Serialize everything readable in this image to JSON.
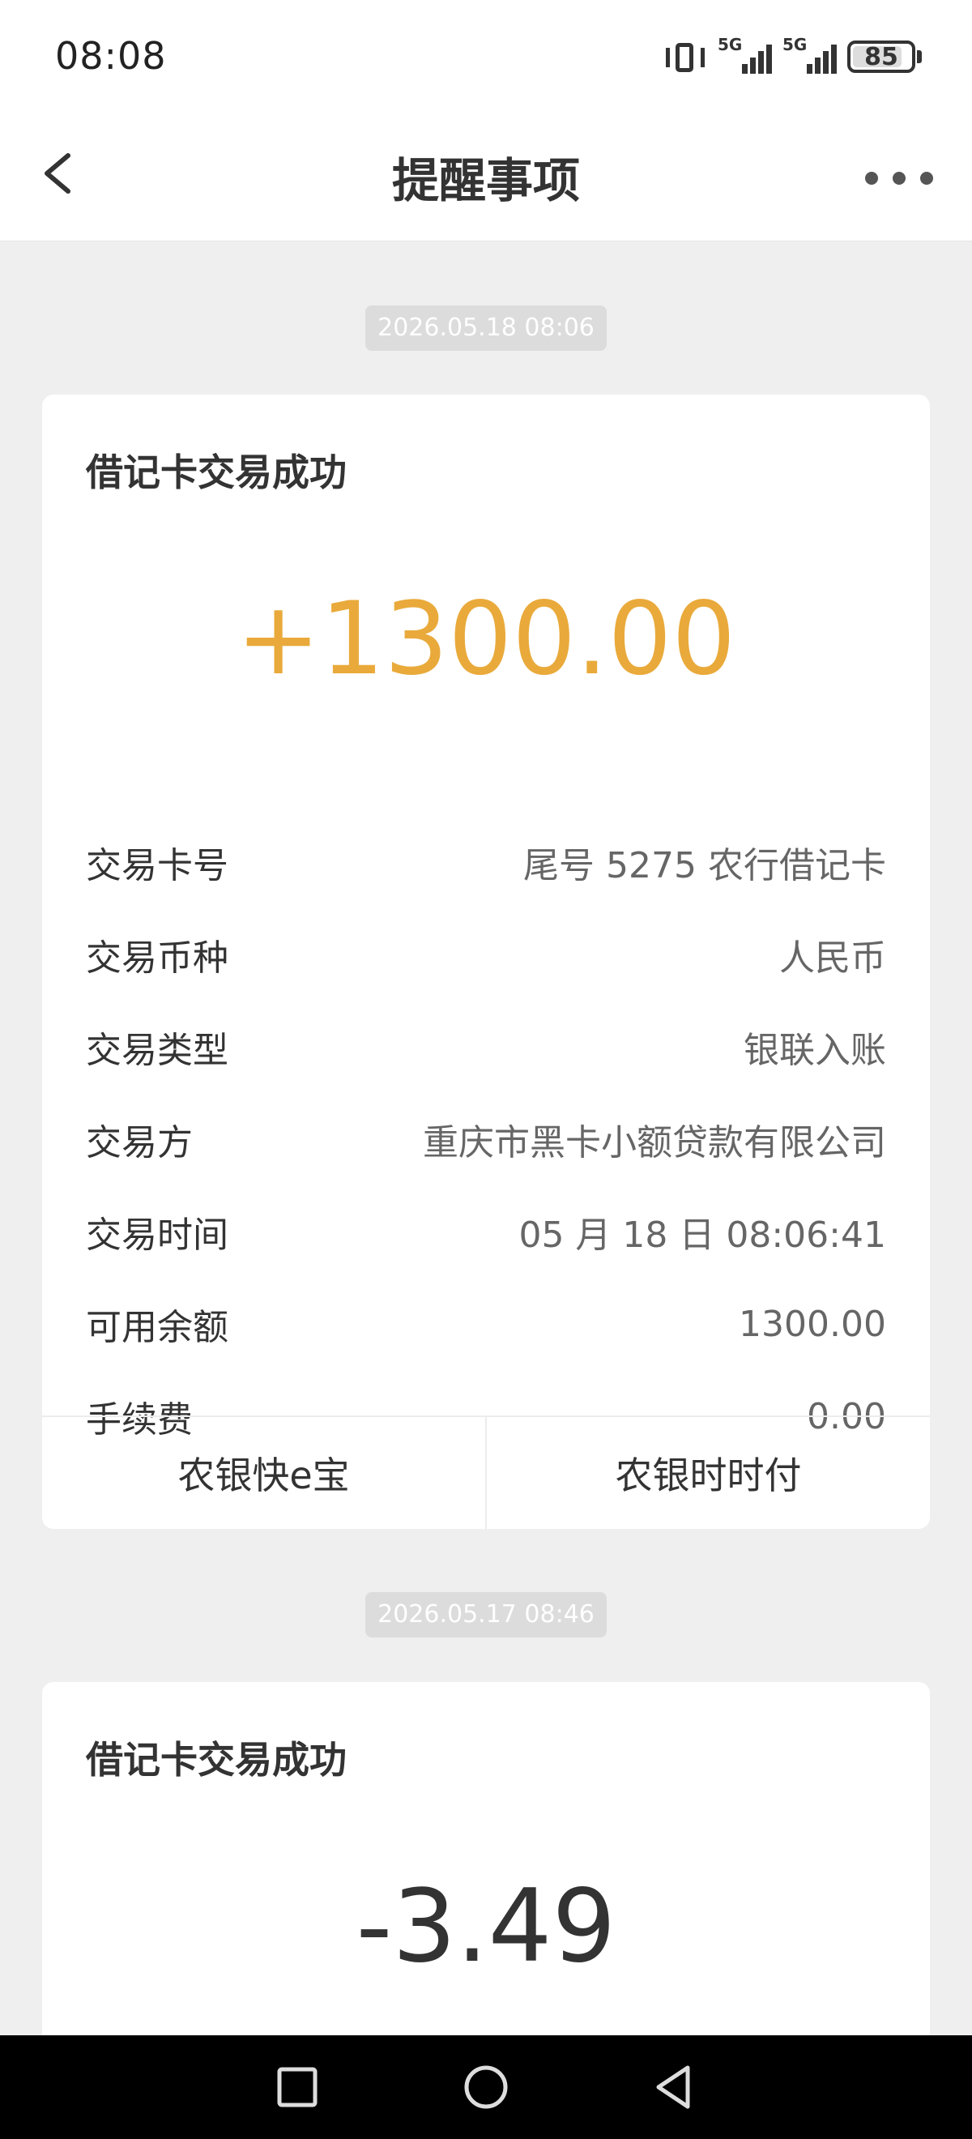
{
  "status_bar": {
    "time": "08:08",
    "network_1": "5G",
    "network_2": "5G",
    "battery": "85"
  },
  "header": {
    "title": "提醒事项"
  },
  "messages": [
    {
      "date": "2026.05.18 08:06",
      "title": "借记卡交易成功",
      "amount": "+1300.00",
      "amount_color": "#e9aa3b",
      "rows": [
        {
          "label": "交易卡号",
          "value": "尾号 5275 农行借记卡"
        },
        {
          "label": "交易币种",
          "value": "人民币"
        },
        {
          "label": "交易类型",
          "value": "银联入账"
        },
        {
          "label": "交易方",
          "value": "重庆市黑卡小额贷款有限公司"
        },
        {
          "label": "交易时间",
          "value": "05 月 18 日 08:06:41"
        },
        {
          "label": "可用余额",
          "value": "1300.00"
        },
        {
          "label": "手续费",
          "value": "0.00"
        }
      ],
      "actions": [
        "农银快e宝",
        "农银时时付"
      ]
    },
    {
      "date": "2026.05.17 08:46",
      "title": "借记卡交易成功",
      "amount": "-3.49",
      "amount_color": "#333333"
    }
  ]
}
